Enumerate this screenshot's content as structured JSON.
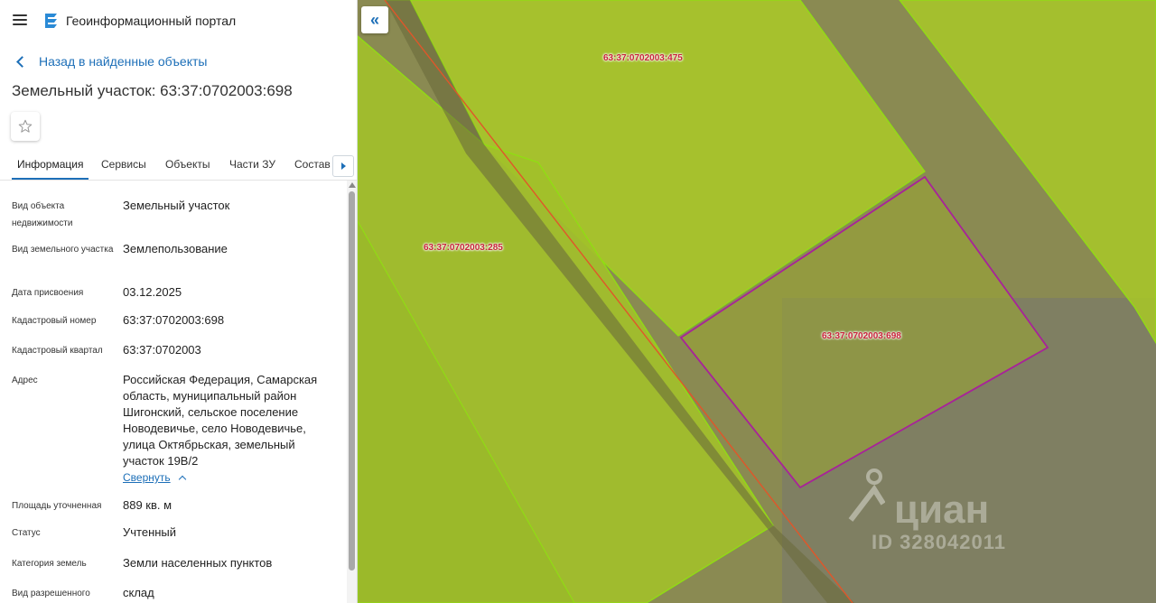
{
  "app": {
    "title": "Геоинформационный портал"
  },
  "nav": {
    "back_label": "Назад в найденные объекты"
  },
  "object": {
    "title": "Земельный участок: 63:37:0702003:698"
  },
  "tabs": [
    {
      "label": "Информация"
    },
    {
      "label": "Сервисы"
    },
    {
      "label": "Объекты"
    },
    {
      "label": "Части ЗУ"
    },
    {
      "label": "Состав"
    }
  ],
  "info": {
    "rows": [
      {
        "label": "Вид объекта недвижимости",
        "value": "Земельный участок"
      },
      {
        "label": "Вид земельного участка",
        "value": "Землепользование"
      },
      {
        "label": "Дата присвоения",
        "value": "03.12.2025"
      },
      {
        "label": "Кадастровый номер",
        "value": "63:37:0702003:698"
      },
      {
        "label": "Кадастровый квартал",
        "value": "63:37:0702003"
      },
      {
        "label": "Адрес",
        "value": "Российская Федерация, Самарская область, муниципальный район Шигонский, сельское поселение Новодевичье, село Новодевичье, улица Октябрьская, земельный участок 19В/2"
      },
      {
        "label": "Площадь уточненная",
        "value": "889 кв. м"
      },
      {
        "label": "Статус",
        "value": "Учтенный"
      },
      {
        "label": "Категория земель",
        "value": "Земли населенных пунктов"
      },
      {
        "label": "Вид разрешенного",
        "value": "склад"
      }
    ],
    "collapse_label": "Свернуть"
  },
  "map": {
    "collapse_symbol": "«",
    "parcels": [
      {
        "label": "63:37:0702003:475"
      },
      {
        "label": "63:37:0702003:285"
      },
      {
        "label": "63:37:0702003:698"
      }
    ],
    "watermark": {
      "brand": "циан",
      "id": "ID 328042011"
    }
  },
  "colors": {
    "accent": "#1d6fb8",
    "parcel_fill": "#a8c62a",
    "selected_outline": "#a8229a",
    "label": "#c8233a"
  }
}
